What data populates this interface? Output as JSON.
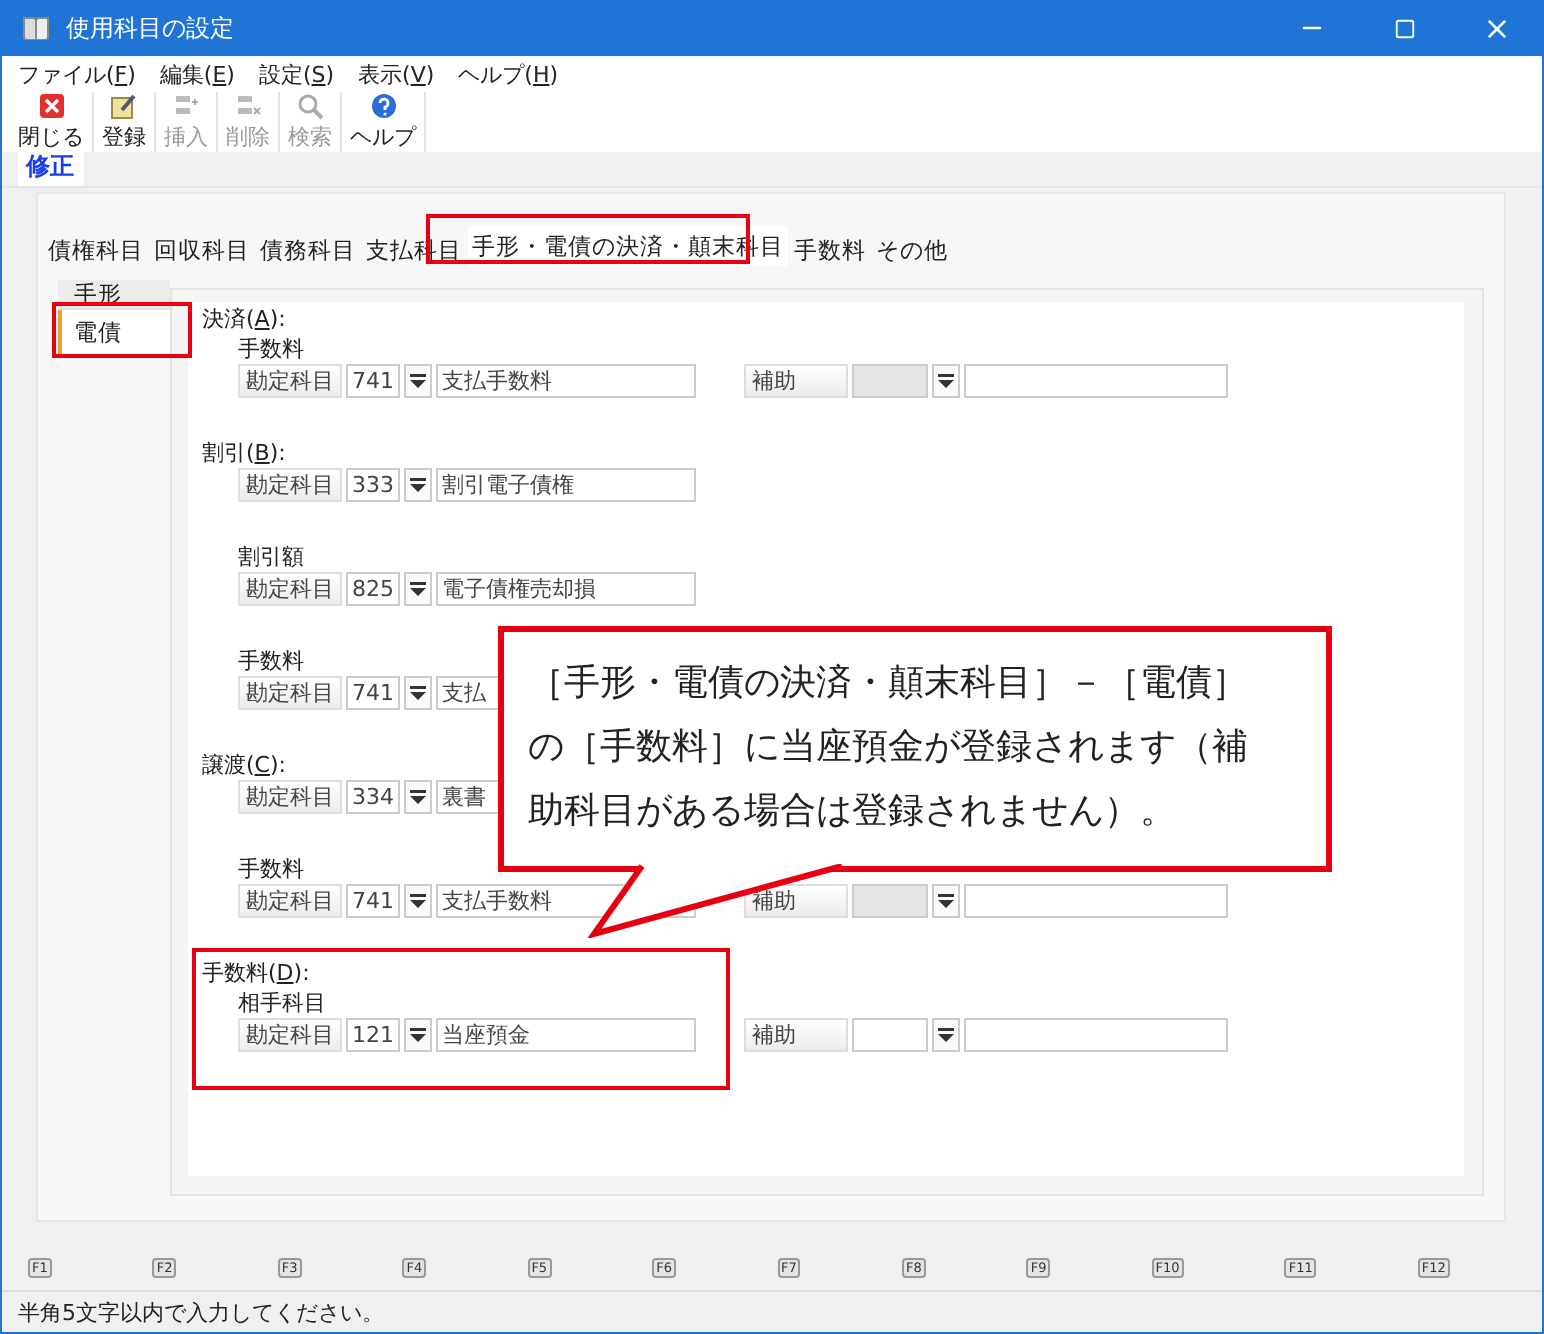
{
  "window": {
    "title": "使用科目の設定"
  },
  "menu": [
    {
      "parts": [
        "ファイル(",
        "F",
        ")"
      ]
    },
    {
      "parts": [
        "編集(",
        "E",
        ")"
      ]
    },
    {
      "parts": [
        "設定(",
        "S",
        ")"
      ]
    },
    {
      "parts": [
        "表示(",
        "V",
        ")"
      ]
    },
    {
      "parts": [
        "ヘルプ(",
        "H",
        ")"
      ]
    }
  ],
  "toolbar": [
    {
      "label": "閉じる",
      "kind": "close",
      "disabled": false
    },
    {
      "label": "登録",
      "kind": "register",
      "disabled": false
    },
    {
      "label": "挿入",
      "kind": "insert",
      "disabled": true
    },
    {
      "label": "削除",
      "kind": "delete",
      "disabled": true
    },
    {
      "label": "検索",
      "kind": "search",
      "disabled": true
    },
    {
      "label": "ヘルプ",
      "kind": "help",
      "disabled": false
    }
  ],
  "mode_tab": {
    "label": "修正"
  },
  "tabs": [
    {
      "label": "債権科目",
      "selected": false
    },
    {
      "label": "回収科目",
      "selected": false
    },
    {
      "label": "債務科目",
      "selected": false
    },
    {
      "label": "支払科目",
      "selected": false
    },
    {
      "label": "手形・電債の決済・顛末科目",
      "selected": true
    },
    {
      "label": "手数料",
      "selected": false
    },
    {
      "label": "その他",
      "selected": false
    }
  ],
  "side_tabs": [
    {
      "label": "手形",
      "selected": false
    },
    {
      "label": "電債",
      "selected": true
    }
  ],
  "sections": [
    {
      "heading": [
        "決済(",
        "A",
        "):"
      ],
      "groups": [
        {
          "subtitle": "手数料",
          "account": {
            "label": "勘定科目",
            "code": "741",
            "name": "支払手数料"
          },
          "sub": {
            "label": "補助",
            "code_disabled": true
          }
        }
      ]
    },
    {
      "heading": [
        "割引(",
        "B",
        "):"
      ],
      "groups": [
        {
          "account": {
            "label": "勘定科目",
            "code": "333",
            "name": "割引電子債権"
          }
        },
        {
          "subtitle": "割引額",
          "account": {
            "label": "勘定科目",
            "code": "825",
            "name": "電子債権売却損"
          }
        },
        {
          "subtitle": "手数料",
          "account": {
            "label": "勘定科目",
            "code": "741",
            "name": "支払"
          }
        }
      ]
    },
    {
      "heading": [
        "譲渡(",
        "C",
        "):"
      ],
      "groups": [
        {
          "account": {
            "label": "勘定科目",
            "code": "334",
            "name": "裏書"
          }
        },
        {
          "subtitle": "手数料",
          "account": {
            "label": "勘定科目",
            "code": "741",
            "name": "支払手数料"
          },
          "sub": {
            "label": "補助",
            "code_disabled": true
          }
        }
      ]
    },
    {
      "heading": [
        "手数料(",
        "D",
        "):"
      ],
      "groups": [
        {
          "subtitle": "相手科目",
          "account": {
            "label": "勘定科目",
            "code": "121",
            "name": "当座預金"
          },
          "sub": {
            "label": "補助",
            "code_disabled": false
          }
        }
      ]
    }
  ],
  "callout": {
    "lines": [
      "［手形・電債の決済・顛末科目］－［電債］",
      "の［手数料］に当座預金が登録されます（補",
      "助科目がある場合は登録されません）。"
    ]
  },
  "function_keys": [
    "F1",
    "F2",
    "F3",
    "F4",
    "F5",
    "F6",
    "F7",
    "F8",
    "F9",
    "F10",
    "F11",
    "F12"
  ],
  "status_bar": {
    "text": "半角5文字以内で入力してください。"
  }
}
